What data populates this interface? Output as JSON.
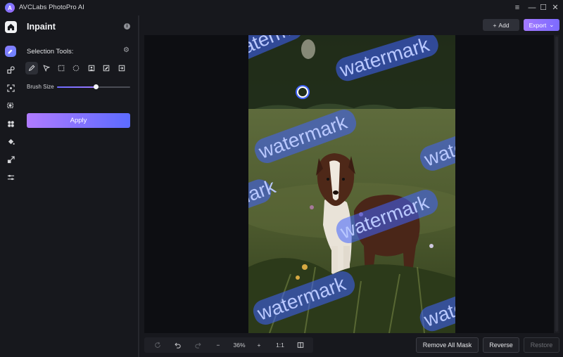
{
  "app": {
    "title": "AVCLabs PhotoPro AI",
    "logo_letter": "A"
  },
  "window_controls": {
    "menu": "≡",
    "minimize": "—",
    "maximize": "☐",
    "close": "✕"
  },
  "panel": {
    "title": "Inpaint",
    "selection_tools_label": "Selection Tools:",
    "brush_size_label": "Brush Size",
    "brush_size_fraction": 0.53,
    "apply_label": "Apply"
  },
  "toolbar": {
    "add_label": "Add",
    "add_symbol": "+",
    "export_label": "Export",
    "export_chevron": "⌄"
  },
  "bottom": {
    "zoom_value": "36%",
    "zoom_out": "−",
    "zoom_in": "+",
    "actual_size": "1:1",
    "remove_all_mask_label": "Remove All Mask",
    "reverse_label": "Reverse",
    "restore_label": "Restore"
  },
  "watermarks": [
    {
      "text": "watermark"
    },
    {
      "text": "watermark"
    },
    {
      "text": "watermark"
    },
    {
      "text": "watermark"
    },
    {
      "text": "watermark"
    },
    {
      "text": "watermark"
    },
    {
      "text": "watermark"
    },
    {
      "text": "watermark"
    }
  ],
  "colors": {
    "accent": "#7c6bff",
    "mask": "#3f63ff",
    "background": "#17181d",
    "canvas": "#0d0e12"
  }
}
